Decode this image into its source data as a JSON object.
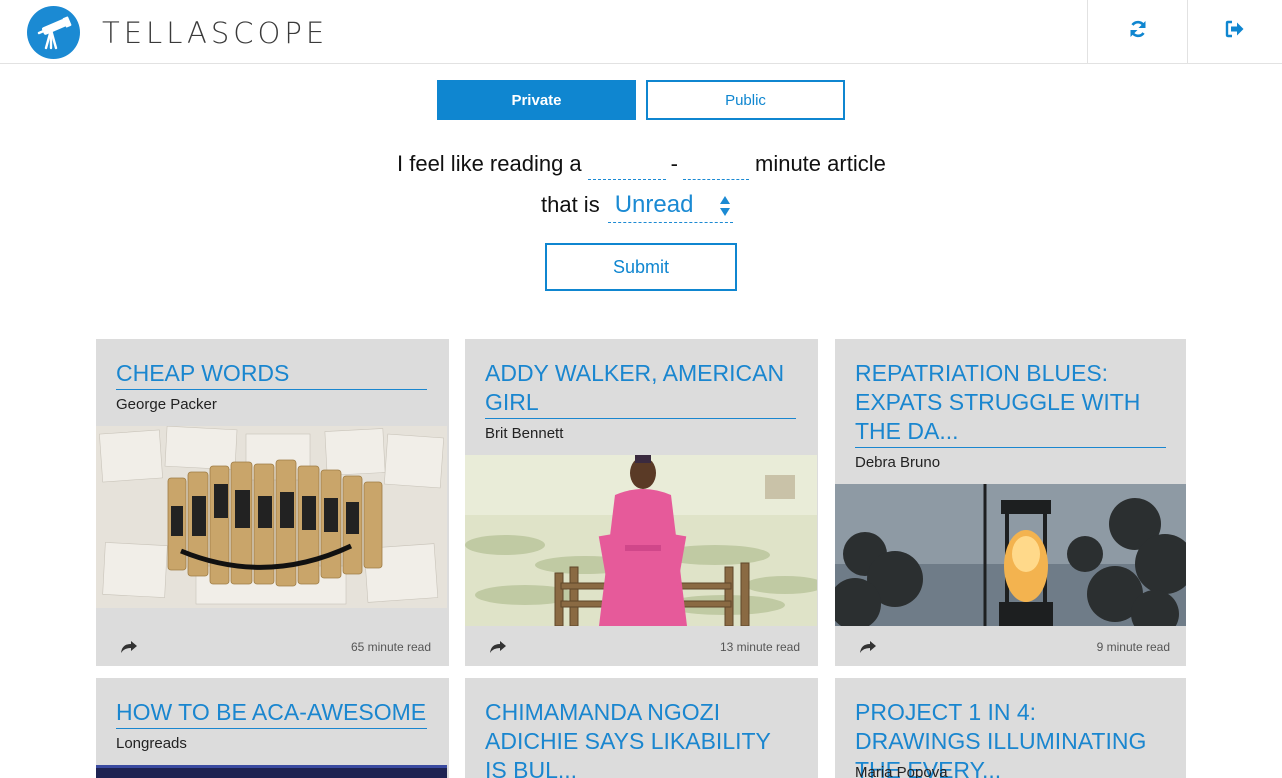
{
  "app": {
    "name": "TELLASCOPE"
  },
  "header": {
    "refresh_icon": "refresh-icon",
    "logout_icon": "sign-out-icon"
  },
  "toggle": {
    "private_label": "Private",
    "public_label": "Public",
    "selected": "Private"
  },
  "form": {
    "prefix": "I feel like reading a",
    "min_value": "",
    "dash": "-",
    "max_value": "",
    "suffix": "minute article",
    "that_is": "that is",
    "status_value": "Unread",
    "submit_label": "Submit"
  },
  "colors": {
    "accent": "#0f86d0",
    "card_bg": "#dcdcdc"
  },
  "cards": [
    {
      "title": "CHEAP WORDS",
      "author": "George Packer",
      "minutes": "65 minute read"
    },
    {
      "title": "ADDY WALKER, AMERICAN GIRL",
      "author": "Brit Bennett",
      "minutes": "13 minute read"
    },
    {
      "title": "REPATRIATION BLUES: EXPATS STRUGGLE WITH THE DA...",
      "author": "Debra Bruno",
      "minutes": "9 minute read"
    },
    {
      "title": "HOW TO BE ACA-AWESOME",
      "author": "Longreads",
      "minutes": ""
    },
    {
      "title": "CHIMAMANDA NGOZI ADICHIE SAYS LIKABILITY IS BUL...",
      "author": "",
      "minutes": ""
    },
    {
      "title": "PROJECT 1 IN 4: DRAWINGS ILLUMINATING THE EVERY...",
      "author": "Maria Popova",
      "minutes": ""
    }
  ]
}
